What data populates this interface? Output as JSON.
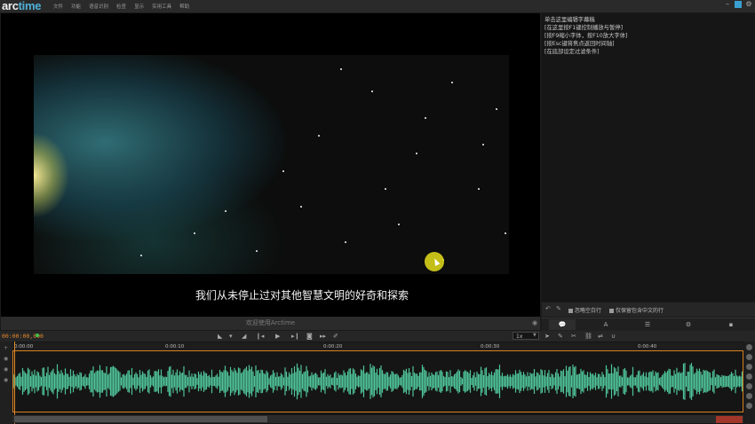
{
  "app": {
    "logo_prefix": "arc",
    "logo_suffix": "time",
    "menu": [
      "文件",
      "功能",
      "语音识别",
      "检查",
      "显示",
      "实用工具",
      "帮助"
    ]
  },
  "video": {
    "subtitle": "我们从未停止过对其他智慧文明的好奇和探索",
    "welcome": "欢迎使用Arctime"
  },
  "subtitle_panel": {
    "hints": [
      "单击这里编辑字幕稿",
      "[在这里按F1键控制播放与暂停]",
      "[按F9缩小字体，按F10放大字体]",
      "[按Esc键将焦点返回时间轴]",
      "[在底部设定过滤条件]"
    ],
    "option_ignore_empty": "忽略空白行",
    "option_chinese_only": "仅保留包含中文的行",
    "tabs": [
      "bubble-icon",
      "font-icon",
      "list-icon",
      "gear-icon",
      "lock-icon"
    ]
  },
  "transport": {
    "timecode": "00:00:00,000",
    "speed": "1x"
  },
  "timeline": {
    "ticks": [
      "0:00:00",
      "0:00:10",
      "0:00:20",
      "0:00:30",
      "0:00:40"
    ]
  },
  "colors": {
    "accent": "#e58a2a",
    "waveform": "#4fc49a",
    "status": "#3fc04a",
    "logo_accent": "#4fb0d8"
  }
}
